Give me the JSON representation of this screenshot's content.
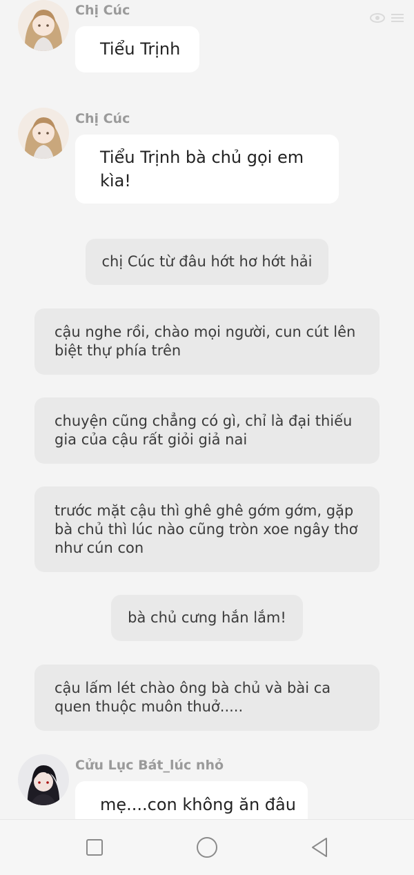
{
  "messages": [
    {
      "type": "chat",
      "sender": "Chị Cúc",
      "text": "Tiểu Trịnh"
    },
    {
      "type": "chat",
      "sender": "Chị Cúc",
      "text": "Tiểu Trịnh bà chủ gọi em kìa!"
    },
    {
      "type": "narration",
      "text": "chị Cúc từ đâu hớt hơ hớt hải"
    },
    {
      "type": "narration",
      "text": "cậu nghe rồi, chào mọi người, cun cút lên biệt thự phía trên"
    },
    {
      "type": "narration",
      "text": "chuyện cũng chẳng có gì, chỉ là đại thiếu gia của cậu rất giỏi giả nai"
    },
    {
      "type": "narration",
      "text": "trước mặt cậu thì ghê ghê gớm gớm, gặp bà chủ thì lúc nào cũng tròn xoe ngây thơ như cún con"
    },
    {
      "type": "narration",
      "text": "bà chủ cưng hắn lắm!"
    },
    {
      "type": "narration",
      "text": "cậu lấm lét chào ông bà chủ và bài ca quen thuộc muôn thuở....."
    },
    {
      "type": "chat",
      "sender": "Cửu Lục Bát_lúc nhỏ",
      "text": "mẹ....con không ăn đâu"
    }
  ],
  "icons": {
    "top": [
      "eye-icon",
      "list-icon"
    ],
    "navbar": [
      "recent-apps-icon",
      "home-icon",
      "back-icon"
    ]
  },
  "colors": {
    "background": "#f4f4f4",
    "chat_bubble": "#ffffff",
    "narration_bubble": "#e9e9e9",
    "sender_name": "#9a9a9a"
  }
}
